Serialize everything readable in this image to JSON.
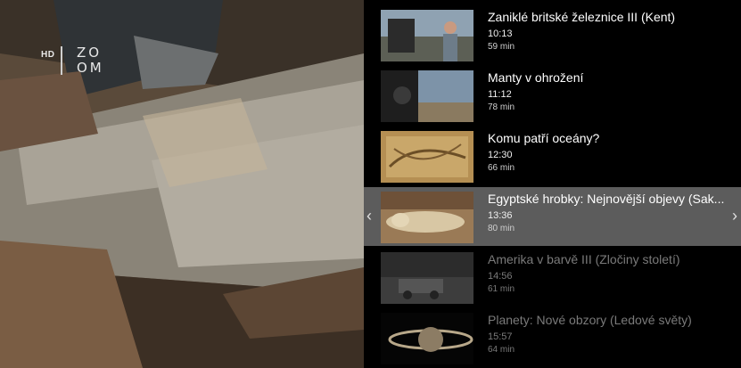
{
  "channel": {
    "hd": "HD",
    "logo_line1": "ZO",
    "logo_line2": "OM"
  },
  "programs": [
    {
      "title": "Zaniklé britské železnice III (Kent)",
      "time": "10:13",
      "duration": "59 min",
      "state": "normal"
    },
    {
      "title": "Manty v ohrožení",
      "time": "11:12",
      "duration": "78 min",
      "state": "normal"
    },
    {
      "title": "Komu patří oceány?",
      "time": "12:30",
      "duration": "66 min",
      "state": "normal"
    },
    {
      "title": "Egyptské hrobky: Nejnovější objevy (Sak...",
      "time": "13:36",
      "duration": "80 min",
      "state": "selected"
    },
    {
      "title": "Amerika v barvě III (Zločiny století)",
      "time": "14:56",
      "duration": "61 min",
      "state": "dim"
    },
    {
      "title": "Planety: Nové obzory (Ledové světy)",
      "time": "15:57",
      "duration": "64 min",
      "state": "dim"
    }
  ],
  "nav": {
    "prev_icon": "chevron-left-icon",
    "next_icon": "chevron-right-icon",
    "prev": "‹",
    "next": "›"
  },
  "colors": {
    "selected_bg": "#5c5c5c",
    "panel_bg": "#000000"
  }
}
